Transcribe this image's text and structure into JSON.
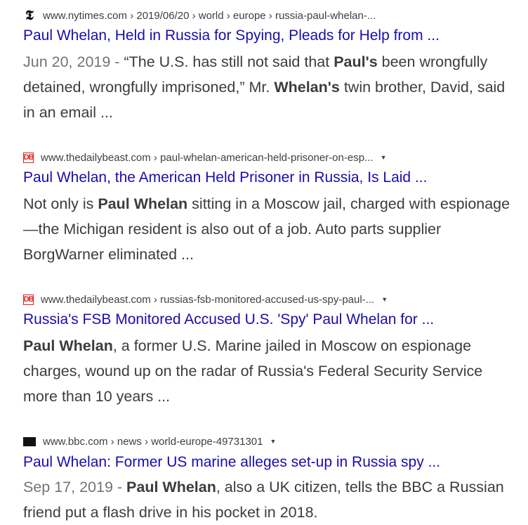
{
  "results": [
    {
      "source": "nytimes",
      "url": "www.nytimes.com › 2019/06/20 › world › europe › russia-paul-whelan-...",
      "has_caret": false,
      "title": "Paul Whelan, Held in Russia for Spying, Pleads for Help from ...",
      "date": "Jun 20, 2019 - ",
      "snippet_parts": [
        {
          "t": "“The U.S. has still not said that ",
          "b": false
        },
        {
          "t": "Paul's",
          "b": true
        },
        {
          "t": " been wrongfully detained, wrongfully imprisoned,” Mr. ",
          "b": false
        },
        {
          "t": "Whelan's",
          "b": true
        },
        {
          "t": " twin brother, David, said in an email ...",
          "b": false
        }
      ]
    },
    {
      "source": "dailybeast",
      "url": "www.thedailybeast.com › paul-whelan-american-held-prisoner-on-esp...",
      "has_caret": true,
      "title": "Paul Whelan, the American Held Prisoner in Russia, Is Laid ...",
      "date": "",
      "snippet_parts": [
        {
          "t": "Not only is ",
          "b": false
        },
        {
          "t": "Paul Whelan",
          "b": true
        },
        {
          "t": " sitting in a Moscow jail, charged with espionage—the Michigan resident is also out of a job. Auto parts supplier BorgWarner eliminated  ...",
          "b": false
        }
      ]
    },
    {
      "source": "dailybeast",
      "url": "www.thedailybeast.com › russias-fsb-monitored-accused-us-spy-paul-...",
      "has_caret": true,
      "title": "Russia's FSB Monitored Accused U.S. 'Spy' Paul Whelan for ...",
      "date": "",
      "snippet_parts": [
        {
          "t": "Paul Whelan",
          "b": true
        },
        {
          "t": ", a former U.S. Marine jailed in Moscow on espionage charges, wound up on the radar of Russia's Federal Security Service more than 10 years ...",
          "b": false
        }
      ]
    },
    {
      "source": "bbc",
      "url": "www.bbc.com › news › world-europe-49731301",
      "has_caret": true,
      "title": "Paul Whelan: Former US marine alleges set-up in Russia spy ...",
      "date": "Sep 17, 2019 - ",
      "snippet_parts": [
        {
          "t": "Paul Whelan",
          "b": true
        },
        {
          "t": ", also a UK citizen, tells the BBC a Russian friend put a flash drive in his pocket in 2018.",
          "b": false
        }
      ]
    }
  ],
  "icons": {
    "nytimes": "nyt-logo-icon",
    "dailybeast": "daily-beast-logo-icon",
    "bbc": "bbc-logo-icon",
    "caret": "caret-down-icon"
  },
  "colors": {
    "title": "#1a0dab",
    "snippet": "#3c3c3c",
    "date": "#70757a",
    "db_red": "#e2231a"
  }
}
